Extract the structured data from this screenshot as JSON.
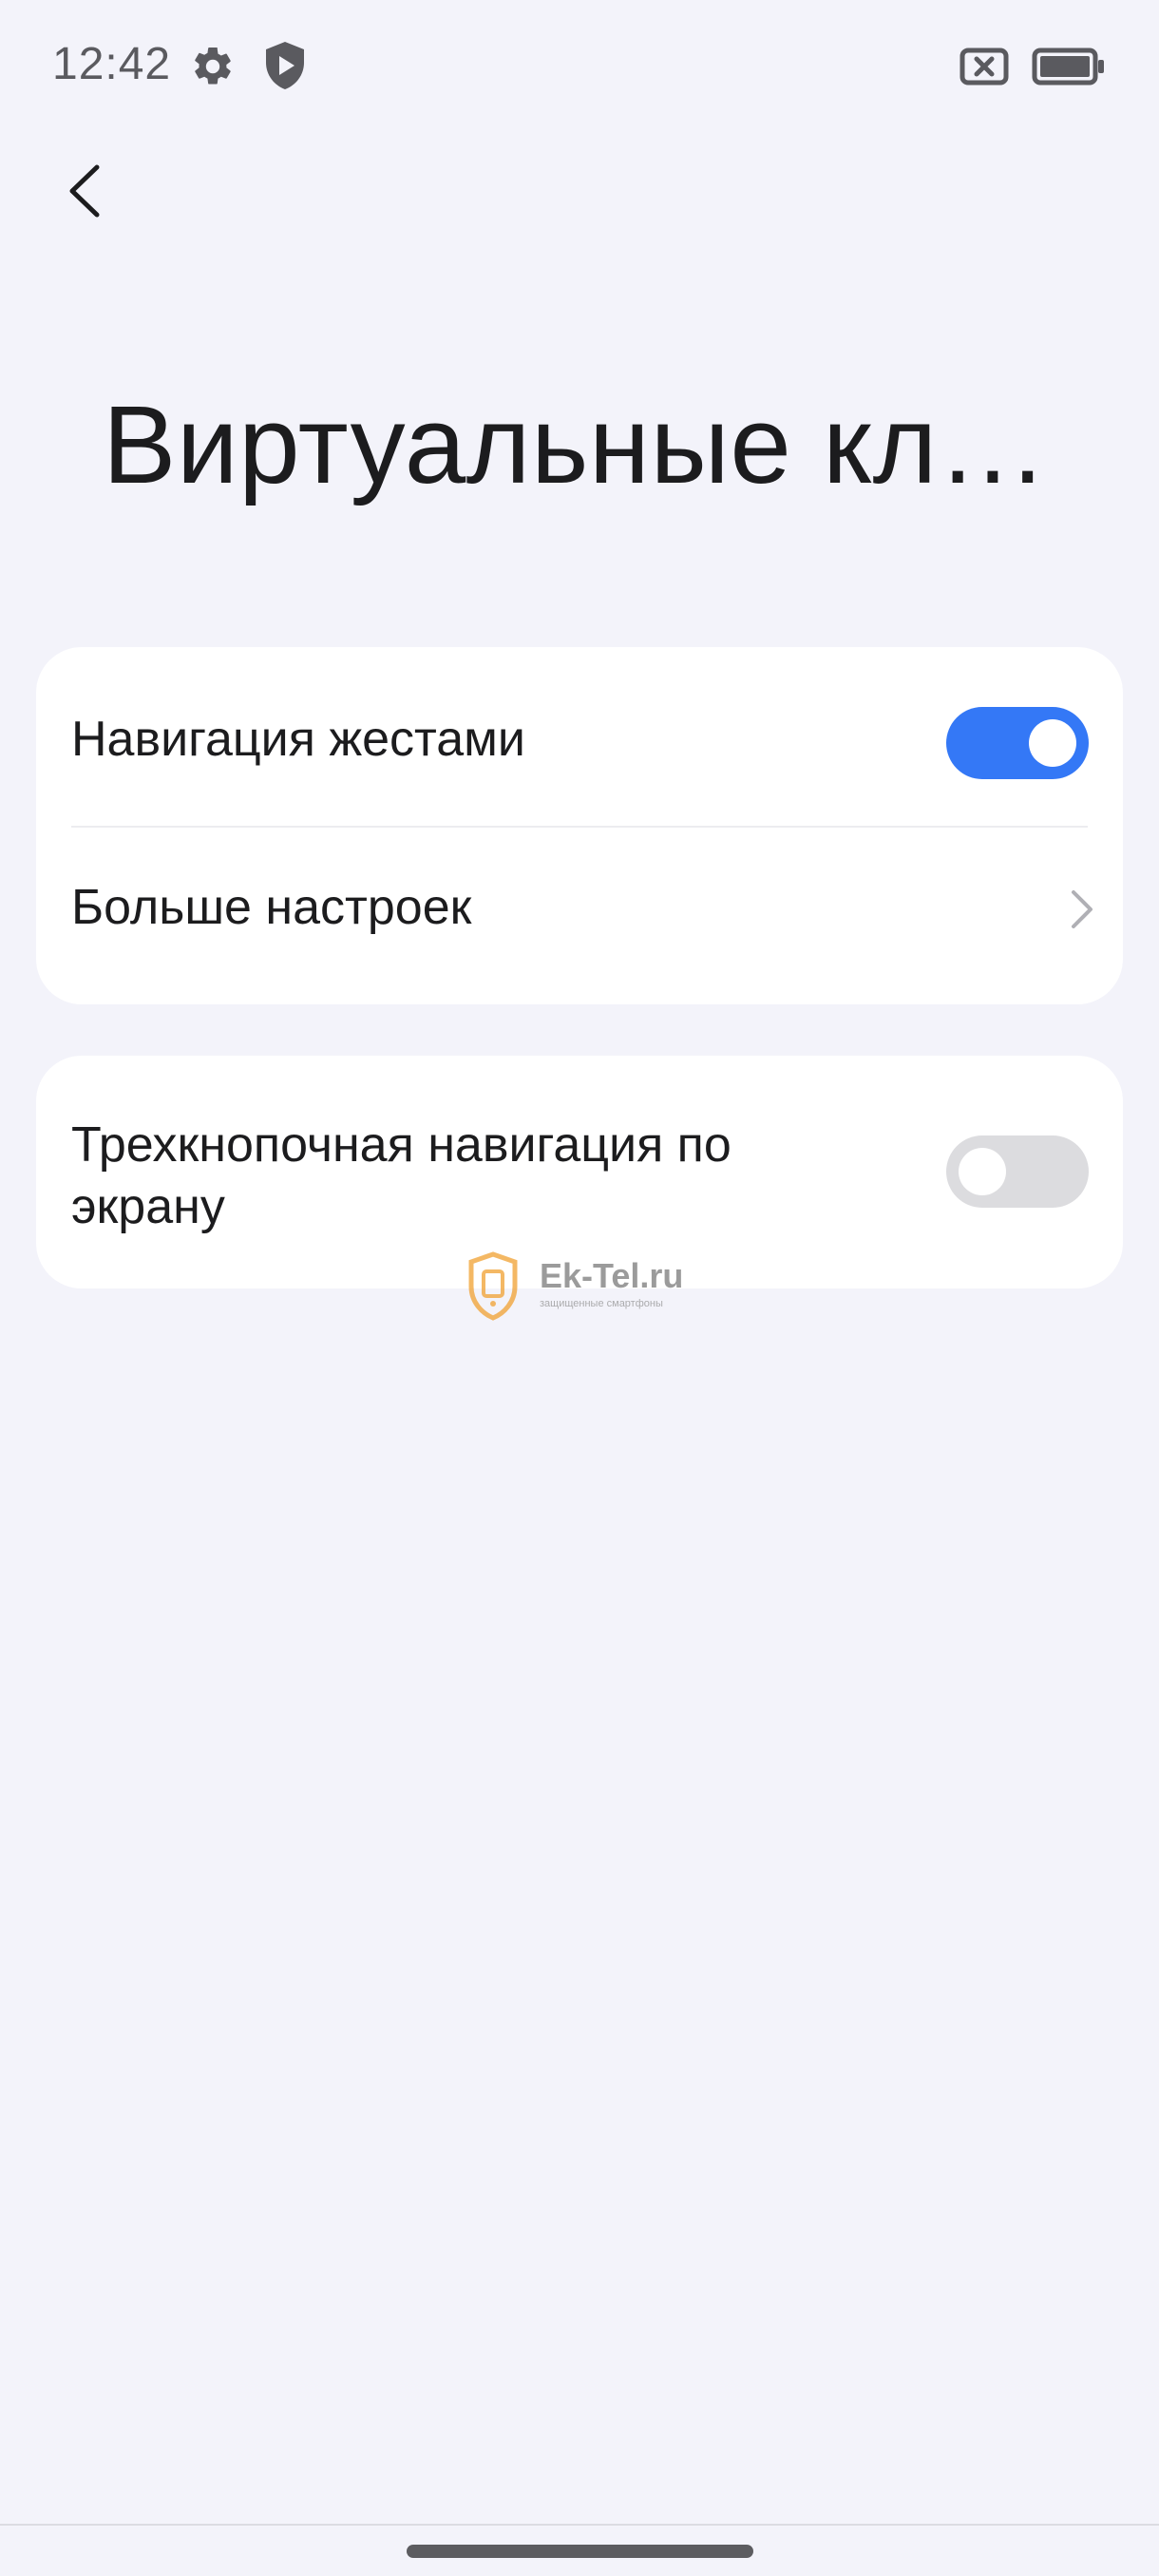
{
  "status_bar": {
    "time": "12:42",
    "icons": [
      "gear-icon",
      "shield-play-icon",
      "no-sim-icon",
      "battery-icon"
    ]
  },
  "header": {
    "back_icon": "chevron-left-icon",
    "title": "Виртуальные кл…"
  },
  "card_1": {
    "gesture_nav": {
      "label": "Навигация жестами",
      "enabled": true
    },
    "more_settings": {
      "label": "Больше настроек",
      "icon": "chevron-right-icon"
    }
  },
  "card_2": {
    "three_button_nav": {
      "label_line_1": "Трехкнопочная навигация по",
      "label_line_2": "экрану",
      "enabled": false
    }
  },
  "watermark": {
    "text": "Ek-Tel.ru",
    "subtext": "защищенные смартфоны"
  },
  "colors": {
    "background": "#f3f3fa",
    "card": "#ffffff",
    "accent": "#3478f6",
    "toggle_off": "#dcdcdf",
    "text": "#1c1c1e",
    "watermark_orange": "#f0a030"
  }
}
